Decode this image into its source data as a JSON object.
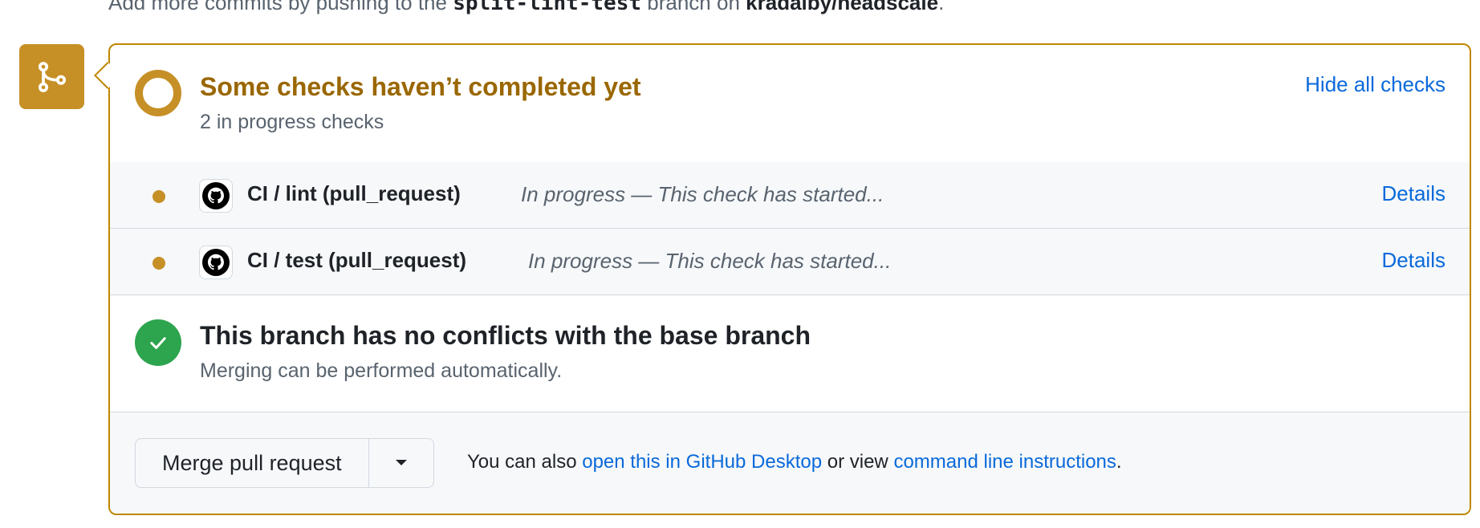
{
  "top_note": {
    "prefix": "Add more commits by pushing to the",
    "branch": "split-lint-test",
    "middle": "branch on",
    "repo": "kradalby/headscale",
    "suffix": "."
  },
  "checks": {
    "title": "Some checks haven’t completed yet",
    "subtitle": "2 in progress checks",
    "hide_link": "Hide all checks",
    "items": [
      {
        "name": "CI / lint (pull_request)",
        "status": "In progress — This check has started...",
        "details": "Details"
      },
      {
        "name": "CI / test (pull_request)",
        "status": "In progress — This check has started...",
        "details": "Details"
      }
    ]
  },
  "conflicts": {
    "title": "This branch has no conflicts with the base branch",
    "subtitle": "Merging can be performed automatically."
  },
  "merge": {
    "button_label": "Merge pull request",
    "note_prefix": "You can also",
    "desktop_link": "open this in GitHub Desktop",
    "note_middle": "or view",
    "cli_link": "command line instructions",
    "note_suffix": "."
  },
  "colors": {
    "pending": "#c69026",
    "pending_text": "#9a6700",
    "success": "#2da44e",
    "link": "#0969da"
  }
}
